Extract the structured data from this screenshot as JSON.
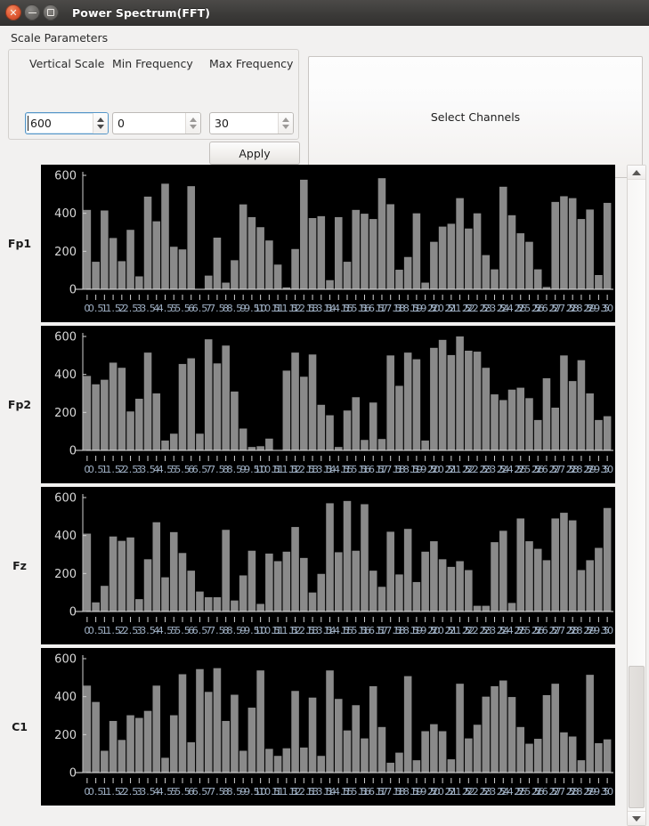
{
  "window": {
    "title": "Power Spectrum(FFT)",
    "buttons": {
      "close": "close-button",
      "minimize": "minimize-button",
      "maximize": "maximize-button"
    }
  },
  "scale_parameters": {
    "legend": "Scale Parameters",
    "vertical_scale_label": "Vertical Scale",
    "min_frequency_label": "Min Frequency",
    "max_frequency_label": "Max Frequency",
    "vertical_scale_value": "600",
    "min_frequency_value": "0",
    "max_frequency_value": "30",
    "apply_label": "Apply"
  },
  "select_channels": {
    "label": "Select Channels"
  },
  "scrollbar": {
    "up": "▲",
    "down": "▼"
  },
  "chart_data": [
    {
      "type": "bar",
      "title": "Fp1",
      "xlabel": "",
      "ylabel": "",
      "ylim": [
        0,
        600
      ],
      "yticks": [
        0,
        200,
        400,
        600
      ],
      "grid": false,
      "xtick_labels": [
        "0",
        "0.5",
        "1",
        "1.5",
        "2",
        "2.5",
        "3",
        "3.5",
        "4",
        "4.5",
        "5",
        "5.5",
        "6",
        "6.5",
        "7",
        "7.5",
        "8",
        "8.5",
        "9",
        "9.5",
        "10",
        "10.5",
        "11",
        "11.5",
        "12",
        "12.5",
        "13",
        "13.5",
        "14",
        "14.5",
        "15",
        "15.5",
        "16",
        "16.5",
        "17",
        "17.5",
        "18",
        "18.5",
        "19",
        "19.5",
        "20",
        "20.5",
        "21",
        "21.5",
        "22",
        "22.5",
        "23",
        "23.5",
        "24",
        "24.5",
        "25",
        "25.5",
        "26",
        "26.5",
        "27",
        "27.5",
        "28",
        "28.5",
        "29",
        "29.5",
        "30"
      ],
      "x": [
        0,
        0.5,
        1,
        1.5,
        2,
        2.5,
        3,
        3.5,
        4,
        4.5,
        5,
        5.5,
        6,
        6.5,
        7,
        7.5,
        8,
        8.5,
        9,
        9.5,
        10,
        10.5,
        11,
        11.5,
        12,
        12.5,
        13,
        13.5,
        14,
        14.5,
        15,
        15.5,
        16,
        16.5,
        17,
        17.5,
        18,
        18.5,
        19,
        19.5,
        20,
        20.5,
        21,
        21.5,
        22,
        22.5,
        23,
        23.5,
        24,
        24.5,
        25,
        25.5,
        26,
        26.5,
        27,
        27.5,
        28,
        28.5,
        29,
        29.5,
        30
      ],
      "values": [
        418,
        145,
        415,
        270,
        148,
        313,
        68,
        488,
        358,
        556,
        224,
        210,
        543,
        0,
        72,
        272,
        35,
        153,
        447,
        380,
        327,
        257,
        130,
        10,
        212,
        577,
        375,
        385,
        48,
        380,
        145,
        418,
        398,
        370,
        585,
        448,
        103,
        170,
        400,
        35,
        250,
        330,
        345,
        480,
        320,
        400,
        180,
        105,
        540,
        390,
        295,
        250,
        105,
        12,
        460,
        490,
        480,
        370,
        420,
        75,
        455
      ]
    },
    {
      "type": "bar",
      "title": "Fp2",
      "xlabel": "",
      "ylabel": "",
      "ylim": [
        0,
        600
      ],
      "yticks": [
        0,
        200,
        400,
        600
      ],
      "grid": false,
      "xtick_labels": [
        "0",
        "0.5",
        "1",
        "1.5",
        "2",
        "2.5",
        "3",
        "3.5",
        "4",
        "4.5",
        "5",
        "5.5",
        "6",
        "6.5",
        "7",
        "7.5",
        "8",
        "8.5",
        "9",
        "9.5",
        "10",
        "10.5",
        "11",
        "11.5",
        "12",
        "12.5",
        "13",
        "13.5",
        "14",
        "14.5",
        "15",
        "15.5",
        "16",
        "16.5",
        "17",
        "17.5",
        "18",
        "18.5",
        "19",
        "19.5",
        "20",
        "20.5",
        "21",
        "21.5",
        "22",
        "22.5",
        "23",
        "23.5",
        "24",
        "24.5",
        "25",
        "25.5",
        "26",
        "26.5",
        "27",
        "27.5",
        "28",
        "28.5",
        "29",
        "29.5",
        "30"
      ],
      "x": [
        0,
        0.5,
        1,
        1.5,
        2,
        2.5,
        3,
        3.5,
        4,
        4.5,
        5,
        5.5,
        6,
        6.5,
        7,
        7.5,
        8,
        8.5,
        9,
        9.5,
        10,
        10.5,
        11,
        11.5,
        12,
        12.5,
        13,
        13.5,
        14,
        14.5,
        15,
        15.5,
        16,
        16.5,
        17,
        17.5,
        18,
        18.5,
        19,
        19.5,
        20,
        20.5,
        21,
        21.5,
        22,
        22.5,
        23,
        23.5,
        24,
        24.5,
        25,
        25.5,
        26,
        26.5,
        27,
        27.5,
        28,
        28.5,
        29,
        29.5,
        30
      ],
      "values": [
        392,
        348,
        372,
        462,
        435,
        205,
        272,
        515,
        300,
        52,
        88,
        455,
        485,
        88,
        585,
        458,
        552,
        310,
        115,
        18,
        22,
        62,
        0,
        420,
        515,
        388,
        505,
        240,
        185,
        18,
        210,
        280,
        55,
        252,
        60,
        500,
        340,
        515,
        480,
        52,
        540,
        582,
        502,
        600,
        525,
        520,
        435,
        295,
        265,
        320,
        330,
        275,
        160,
        380,
        225,
        500,
        365,
        475,
        300,
        160,
        180
      ]
    },
    {
      "type": "bar",
      "title": "Fz",
      "xlabel": "",
      "ylabel": "",
      "ylim": [
        0,
        600
      ],
      "yticks": [
        0,
        200,
        400,
        600
      ],
      "grid": false,
      "xtick_labels": [
        "0",
        "0.5",
        "1",
        "1.5",
        "2",
        "2.5",
        "3",
        "3.5",
        "4",
        "4.5",
        "5",
        "5.5",
        "6",
        "6.5",
        "7",
        "7.5",
        "8",
        "8.5",
        "9",
        "9.5",
        "10",
        "10.5",
        "11",
        "11.5",
        "12",
        "12.5",
        "13",
        "13.5",
        "14",
        "14.5",
        "15",
        "15.5",
        "16",
        "16.5",
        "17",
        "17.5",
        "18",
        "18.5",
        "19",
        "19.5",
        "20",
        "20.5",
        "21",
        "21.5",
        "22",
        "22.5",
        "23",
        "23.5",
        "24",
        "24.5",
        "25",
        "25.5",
        "26",
        "26.5",
        "27",
        "27.5",
        "28",
        "28.5",
        "29",
        "29.5",
        "30"
      ],
      "x": [
        0,
        0.5,
        1,
        1.5,
        2,
        2.5,
        3,
        3.5,
        4,
        4.5,
        5,
        5.5,
        6,
        6.5,
        7,
        7.5,
        8,
        8.5,
        9,
        9.5,
        10,
        10.5,
        11,
        11.5,
        12,
        12.5,
        13,
        13.5,
        14,
        14.5,
        15,
        15.5,
        16,
        16.5,
        17,
        17.5,
        18,
        18.5,
        19,
        19.5,
        20,
        20.5,
        21,
        21.5,
        22,
        22.5,
        23,
        23.5,
        24,
        24.5,
        25,
        25.5,
        26,
        26.5,
        27,
        27.5,
        28,
        28.5,
        29,
        29.5,
        30
      ],
      "values": [
        410,
        48,
        135,
        395,
        372,
        390,
        65,
        275,
        470,
        180,
        418,
        308,
        215,
        105,
        75,
        75,
        430,
        58,
        190,
        320,
        40,
        305,
        265,
        315,
        445,
        282,
        100,
        198,
        570,
        312,
        582,
        320,
        565,
        215,
        130,
        420,
        195,
        435,
        155,
        315,
        370,
        275,
        235,
        265,
        218,
        30,
        30,
        365,
        425,
        45,
        490,
        370,
        330,
        270,
        490,
        520,
        480,
        218,
        270,
        335,
        545
      ]
    },
    {
      "type": "bar",
      "title": "C1",
      "xlabel": "",
      "ylabel": "",
      "ylim": [
        0,
        600
      ],
      "yticks": [
        0,
        200,
        400,
        600
      ],
      "grid": false,
      "xtick_labels": [
        "0",
        "0.5",
        "1",
        "1.5",
        "2",
        "2.5",
        "3",
        "3.5",
        "4",
        "4.5",
        "5",
        "5.5",
        "6",
        "6.5",
        "7",
        "7.5",
        "8",
        "8.5",
        "9",
        "9.5",
        "10",
        "10.5",
        "11",
        "11.5",
        "12",
        "12.5",
        "13",
        "13.5",
        "14",
        "14.5",
        "15",
        "15.5",
        "16",
        "16.5",
        "17",
        "17.5",
        "18",
        "18.5",
        "19",
        "19.5",
        "20",
        "20.5",
        "21",
        "21.5",
        "22",
        "22.5",
        "23",
        "23.5",
        "24",
        "24.5",
        "25",
        "25.5",
        "26",
        "26.5",
        "27",
        "27.5",
        "28",
        "28.5",
        "29",
        "29.5",
        "30"
      ],
      "x": [
        0,
        0.5,
        1,
        1.5,
        2,
        2.5,
        3,
        3.5,
        4,
        4.5,
        5,
        5.5,
        6,
        6.5,
        7,
        7.5,
        8,
        8.5,
        9,
        9.5,
        10,
        10.5,
        11,
        11.5,
        12,
        12.5,
        13,
        13.5,
        14,
        14.5,
        15,
        15.5,
        16,
        16.5,
        17,
        17.5,
        18,
        18.5,
        19,
        19.5,
        20,
        20.5,
        21,
        21.5,
        22,
        22.5,
        23,
        23.5,
        24,
        24.5,
        25,
        25.5,
        26,
        26.5,
        27,
        27.5,
        28,
        28.5,
        29,
        29.5,
        30
      ],
      "values": [
        458,
        372,
        115,
        272,
        172,
        302,
        288,
        325,
        458,
        78,
        302,
        518,
        160,
        545,
        425,
        550,
        272,
        410,
        115,
        342,
        538,
        125,
        88,
        128,
        430,
        132,
        395,
        88,
        538,
        388,
        222,
        355,
        180,
        455,
        240,
        52,
        105,
        508,
        65,
        218,
        255,
        218,
        70,
        468,
        180,
        252,
        400,
        455,
        485,
        398,
        240,
        152,
        178,
        408,
        468,
        212,
        190,
        65,
        515,
        155,
        175
      ]
    }
  ]
}
